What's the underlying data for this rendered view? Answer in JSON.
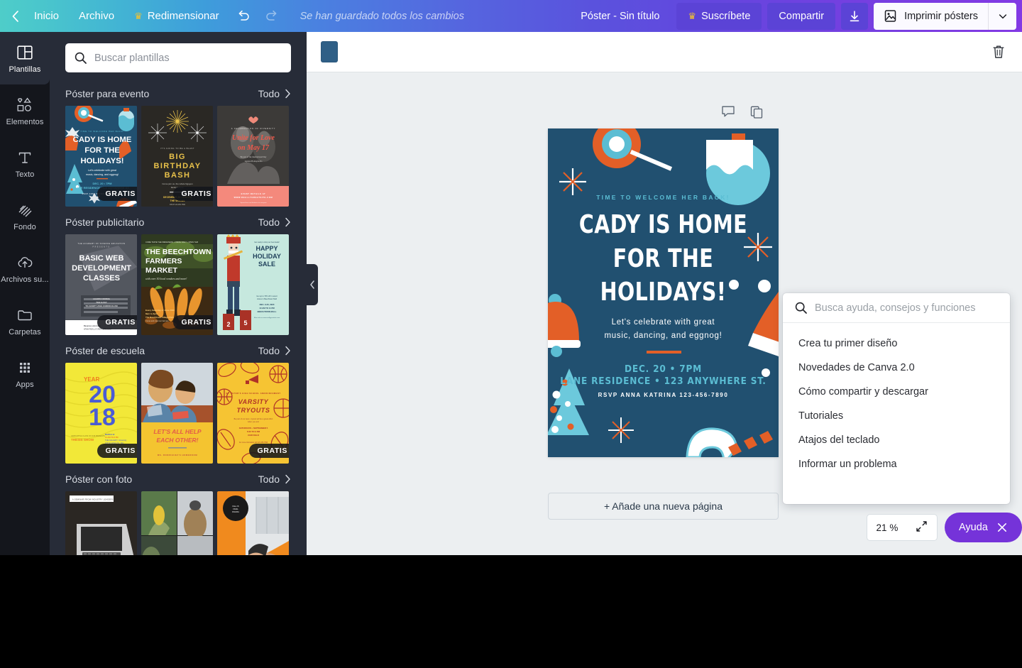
{
  "topbar": {
    "back_icon": "chevron-left-icon",
    "home_label": "Inicio",
    "file_label": "Archivo",
    "resize_label": "Redimensionar",
    "resize_icon": "crown-icon",
    "undo_icon": "undo-icon",
    "redo_icon": "redo-icon",
    "save_status": "Se han guardado todos los cambios",
    "doc_title": "Póster - Sin título",
    "subscribe_label": "Suscríbete",
    "subscribe_icon": "crown-icon",
    "share_label": "Compartir",
    "download_icon": "download-icon",
    "print_label": "Imprimir pósters",
    "print_icon": "poster-print-icon",
    "print_caret_icon": "chevron-down-icon",
    "accent_purple": "#5b43d6",
    "crown_gold": "#f2c230"
  },
  "rail": {
    "items": [
      {
        "label": "Plantillas",
        "icon": "layout-grid-icon",
        "active": true
      },
      {
        "label": "Elementos",
        "icon": "shapes-icon",
        "active": false
      },
      {
        "label": "Texto",
        "icon": "text-t-icon",
        "active": false
      },
      {
        "label": "Fondo",
        "icon": "hatch-pattern-icon",
        "active": false
      },
      {
        "label": "Archivos su...",
        "icon": "cloud-upload-icon",
        "active": false
      },
      {
        "label": "Carpetas",
        "icon": "folder-icon",
        "active": false
      },
      {
        "label": "Apps",
        "icon": "apps-grid-icon",
        "active": false
      }
    ]
  },
  "panel": {
    "search_placeholder": "Buscar plantillas",
    "search_value": "",
    "search_icon": "search-icon",
    "all_label": "Todo",
    "all_icon": "chevron-right-icon",
    "collapse_icon": "chevron-left-icon",
    "free_badge": "GRATIS",
    "categories": [
      {
        "title": "Póster para evento",
        "thumbs": [
          {
            "name": "cady-is-home-for-the-holidays",
            "free": true,
            "title_text": "CADY IS HOME FOR THE HOLIDAYS!"
          },
          {
            "name": "big-birthday-bash",
            "free": true,
            "title_text": "BIG BIRTHDAY BASH"
          },
          {
            "name": "unite-for-love-on-may-17",
            "free": false,
            "title_text": "Unite for Love on May 17"
          }
        ]
      },
      {
        "title": "Póster publicitario",
        "thumbs": [
          {
            "name": "basic-web-development-classes",
            "free": true,
            "title_text": "BASIC WEB DEVELOPMENT CLASSES"
          },
          {
            "name": "the-beechtown-farmers-market",
            "free": true,
            "title_text": "THE BEECHTOWN FARMERS MARKET"
          },
          {
            "name": "happy-holiday-sale",
            "free": false,
            "title_text": "HAPPY HOLIDAY SALE"
          }
        ]
      },
      {
        "title": "Póster de escuela",
        "thumbs": [
          {
            "name": "year-2018-thesis-show",
            "free": true,
            "title_text": "YEAR 2018"
          },
          {
            "name": "lets-all-help-each-other",
            "free": false,
            "title_text": "LET'S ALL HELP EACH OTHER!"
          },
          {
            "name": "varsity-tryouts",
            "free": true,
            "title_text": "VARSITY TRYOUTS"
          }
        ]
      },
      {
        "title": "Póster con foto",
        "thumbs": [
          {
            "name": "laptop-photo-poster",
            "free": false,
            "title_text": ""
          },
          {
            "name": "collage-photo-poster",
            "free": false,
            "title_text": ""
          },
          {
            "name": "orange-photo-poster",
            "free": false,
            "title_text": ""
          }
        ]
      }
    ]
  },
  "context_bar": {
    "swatch_color": "#2f5f86",
    "swatch_name": "page-color-swatch",
    "trash_icon": "trash-icon"
  },
  "page_tools": {
    "comment_icon": "comment-icon",
    "duplicate_icon": "duplicate-icon"
  },
  "poster": {
    "background": "#215070",
    "accent_orange": "#e35f27",
    "accent_teal": "#5bbdd3",
    "kicker": "TIME TO WELCOME HER BACK!",
    "title_line1": "CADY IS HOME",
    "title_line2": "FOR THE",
    "title_line3": "HOLIDAYS!",
    "subtitle_line1": "Let's celebrate with great",
    "subtitle_line2": "music, dancing, and eggnog!",
    "when": "DEC. 20 • 7PM",
    "where": "LANE RESIDENCE • 123 ANYWHERE ST.",
    "rsvp": "RSVP ANNA KATRINA 123-456-7890"
  },
  "add_page_label": "+ Añade una nueva página",
  "help": {
    "search_placeholder": "Busca ayuda, consejos y funciones",
    "search_value": "",
    "search_icon": "search-icon",
    "items": [
      "Crea tu primer diseño",
      "Novedades de Canva 2.0",
      "Cómo compartir y descargar",
      "Tutoriales",
      "Atajos del teclado",
      "Informar un problema"
    ]
  },
  "zoom_control": {
    "value": "21 %",
    "expand_icon": "expand-arrows-icon"
  },
  "help_button": {
    "label": "Ayuda",
    "close_icon": "close-x-icon",
    "color": "#7533d9"
  }
}
